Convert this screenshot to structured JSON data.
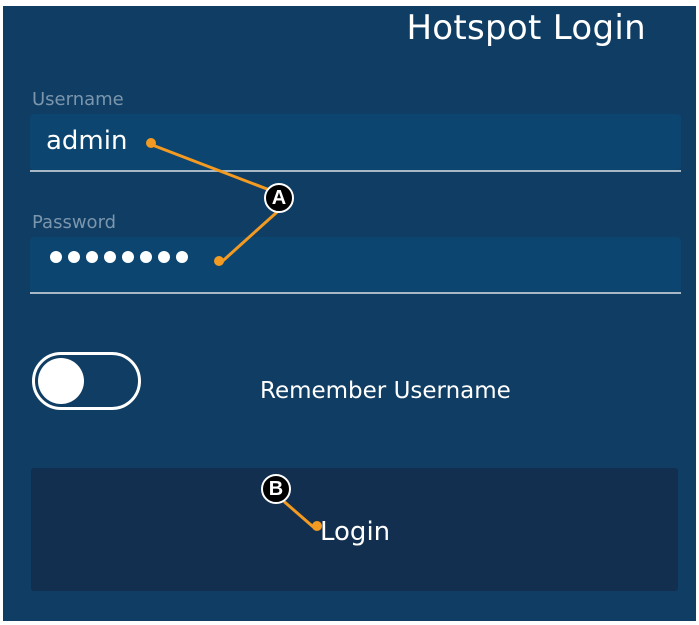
{
  "header": {
    "title": "Hotspot Login"
  },
  "form": {
    "username": {
      "label": "Username",
      "value": "admin"
    },
    "password": {
      "label": "Password",
      "mask_count": 8
    },
    "remember": {
      "label": "Remember Username",
      "enabled": false
    },
    "login_button": {
      "label": "Login"
    }
  },
  "annotations": {
    "marker_a": "A",
    "marker_b": "B"
  },
  "colors": {
    "background": "#0f3d63",
    "field": "#0c4670",
    "button": "#122f4f",
    "annotation": "#f29a21",
    "text": "#ffffff",
    "label": "#7b96ad"
  },
  "icons": {
    "toggle": "toggle-switch-icon",
    "marker": "callout-marker-icon"
  }
}
